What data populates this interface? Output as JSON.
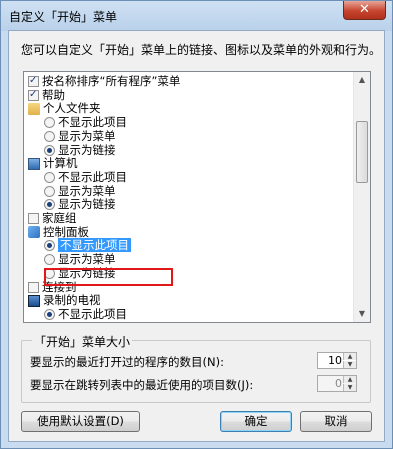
{
  "window": {
    "title": "自定义「开始」菜单",
    "close_label": "✕"
  },
  "description": "您可以自定义「开始」菜单上的链接、图标以及菜单的外观和行为。",
  "list": {
    "items": [
      {
        "type": "checkbox",
        "checked": true,
        "label": "按名称排序“所有程序”菜单"
      },
      {
        "type": "checkbox",
        "checked": true,
        "label": "帮助"
      },
      {
        "type": "header",
        "icon": "folder-icon",
        "label": "个人文件夹"
      },
      {
        "type": "radio",
        "checked": false,
        "label": "不显示此项目"
      },
      {
        "type": "radio",
        "checked": false,
        "label": "显示为菜单"
      },
      {
        "type": "radio",
        "checked": true,
        "label": "显示为链接"
      },
      {
        "type": "header",
        "icon": "computer-icon",
        "label": "计算机"
      },
      {
        "type": "radio",
        "checked": false,
        "label": "不显示此项目"
      },
      {
        "type": "radio",
        "checked": false,
        "label": "显示为菜单"
      },
      {
        "type": "radio",
        "checked": true,
        "label": "显示为链接"
      },
      {
        "type": "checkbox",
        "checked": false,
        "label": "家庭组"
      },
      {
        "type": "header",
        "icon": "control-panel-icon",
        "label": "控制面板"
      },
      {
        "type": "radio",
        "checked": true,
        "selected": true,
        "label": "不显示此项目"
      },
      {
        "type": "radio",
        "checked": false,
        "label": "显示为菜单"
      },
      {
        "type": "radio",
        "checked": false,
        "label": "显示为链接"
      },
      {
        "type": "checkbox",
        "checked": false,
        "label": "连接到"
      },
      {
        "type": "header",
        "icon": "tv-icon",
        "label": "录制的电视"
      },
      {
        "type": "radio",
        "checked": true,
        "label": "不显示此项目"
      }
    ]
  },
  "size_group": {
    "legend": "「开始」菜单大小",
    "recent_programs_label": "要显示的最近打开过的程序的数目(N):",
    "recent_programs_value": "10",
    "jumplist_label": "要显示在跳转列表中的最近使用的项目数(J):",
    "jumplist_value": "0"
  },
  "buttons": {
    "defaults": "使用默认设置(D)",
    "ok": "确定",
    "cancel": "取消"
  }
}
